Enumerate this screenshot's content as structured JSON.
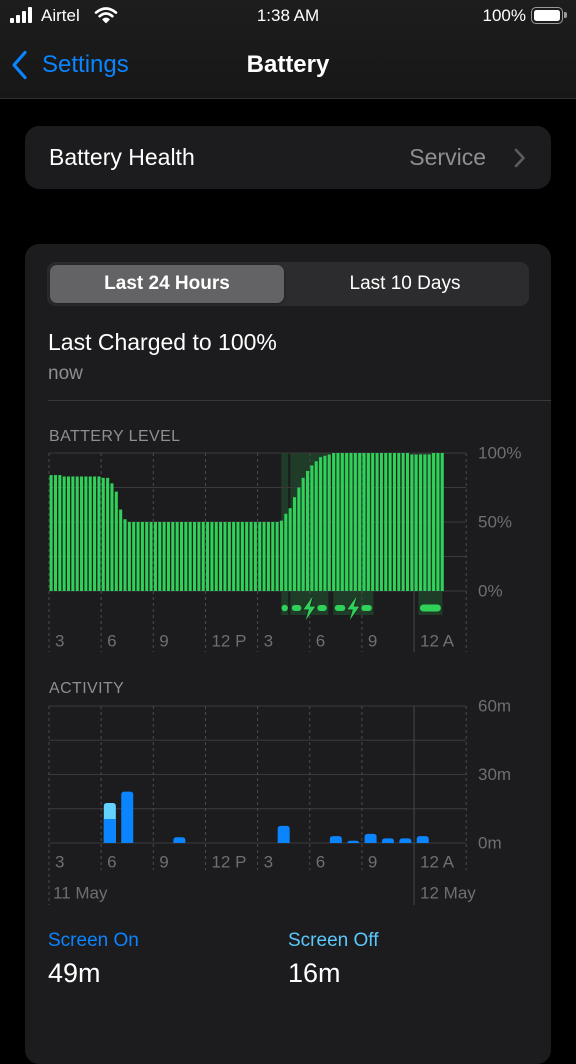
{
  "status_bar": {
    "carrier": "Airtel",
    "time": "1:38 AM",
    "battery_percent": "100%",
    "signal_strength_bars": 4,
    "signal_max_bars": 4,
    "battery_fill_fraction": 1.0
  },
  "nav": {
    "back_label": "Settings",
    "title": "Battery"
  },
  "battery_health": {
    "label": "Battery Health",
    "value": "Service"
  },
  "range_selector": {
    "options": [
      {
        "label": "Last 24 Hours",
        "selected": true
      },
      {
        "label": "Last 10 Days",
        "selected": false
      }
    ]
  },
  "last_charged": {
    "title": "Last Charged to 100%",
    "subtitle": "now"
  },
  "sections": {
    "battery_level": "BATTERY LEVEL",
    "activity": "ACTIVITY"
  },
  "summary": {
    "screen_on_label": "Screen On",
    "screen_on_value": "49m",
    "screen_off_label": "Screen Off",
    "screen_off_value": "16m"
  },
  "colors": {
    "accent_blue": "#0a84ff",
    "screen_on_blue": "#0a84ff",
    "screen_off_blue": "#64d2ff",
    "screen_off_label": "#5ac8fa",
    "battery_green": "#30d158",
    "secondary_text": "#8e8e93",
    "axis_text": "#6e6e73"
  },
  "chart_data": [
    {
      "type": "bar",
      "title": "BATTERY LEVEL",
      "interval_minutes": 15,
      "start_time": "3 AM",
      "x_range_hours": 24,
      "x_tick_labels": [
        "3",
        "6",
        "9",
        "12 P",
        "3",
        "6",
        "9",
        "12 A"
      ],
      "x_tick_hours": [
        0,
        3,
        6,
        9,
        12,
        15,
        18,
        21
      ],
      "day_boundary_hour": 21,
      "ylim": [
        0,
        100
      ],
      "y_unit": "%",
      "y_tick_values": [
        100,
        50,
        0
      ],
      "y_tick_labels": [
        "100%",
        "50%",
        "0%"
      ],
      "grid": true,
      "values": [
        84,
        84,
        84,
        83,
        83,
        83,
        83,
        83,
        83,
        83,
        83,
        83,
        82,
        82,
        78,
        72,
        59,
        52,
        50,
        50,
        50,
        50,
        50,
        50,
        50,
        50,
        50,
        50,
        50,
        50,
        50,
        50,
        50,
        50,
        50,
        50,
        50,
        50,
        50,
        50,
        50,
        50,
        50,
        50,
        50,
        50,
        50,
        50,
        50,
        50,
        50,
        50,
        50,
        51,
        56,
        60,
        68,
        75,
        82,
        87,
        91,
        94,
        97,
        98,
        99,
        100,
        100,
        100,
        100,
        100,
        100,
        100,
        100,
        100,
        100,
        100,
        100,
        100,
        100,
        100,
        100,
        100,
        100,
        99,
        99,
        99,
        99,
        99,
        100,
        100,
        100,
        null,
        null,
        null,
        null,
        null
      ],
      "charging_periods": [
        {
          "start_hour": 13.36,
          "end_hour": 13.76
        },
        {
          "start_hour": 13.88,
          "end_hour": 16.07,
          "icon": "lightning-bolt-icon"
        },
        {
          "start_hour": 16.35,
          "end_hour": 18.66,
          "icon": "lightning-bolt-icon"
        },
        {
          "start_hour": 21.25,
          "end_hour": 22.63
        }
      ]
    },
    {
      "type": "bar",
      "stacked": true,
      "title": "ACTIVITY",
      "interval_minutes": 60,
      "start_time": "3 AM",
      "x_range_hours": 24,
      "x_tick_labels": [
        "3",
        "6",
        "9",
        "12 P",
        "3",
        "6",
        "9",
        "12 A"
      ],
      "x_tick_hours": [
        0,
        3,
        6,
        9,
        12,
        15,
        18,
        21
      ],
      "day_boundary_hour": 21,
      "date_labels": [
        {
          "label": "11 May",
          "hour": 0
        },
        {
          "label": "12 May",
          "hour": 21
        }
      ],
      "ylim": [
        0,
        60
      ],
      "y_unit": "min",
      "y_tick_values": [
        60,
        30,
        0
      ],
      "y_tick_labels": [
        "60m",
        "30m",
        "0m"
      ],
      "grid": true,
      "series": [
        {
          "name": "Screen On",
          "color": "#0a84ff",
          "values": [
            0,
            0,
            0,
            10.5,
            22.5,
            0,
            0,
            2.5,
            0,
            0,
            0,
            0,
            0,
            7.5,
            0,
            0,
            3,
            1,
            4,
            2,
            2,
            3,
            0,
            0
          ]
        },
        {
          "name": "Screen Off",
          "color": "#64d2ff",
          "values": [
            0,
            0,
            0,
            7,
            0,
            0,
            0,
            0,
            0,
            0,
            0,
            0,
            0,
            0,
            0,
            0,
            0,
            0,
            0,
            0,
            0,
            0,
            0,
            0
          ]
        }
      ]
    }
  ]
}
